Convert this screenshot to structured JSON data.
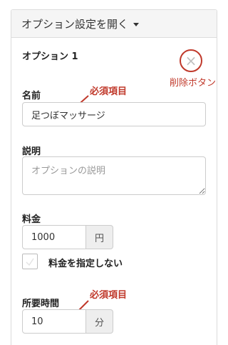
{
  "header": {
    "title": "オプション設定を開く"
  },
  "option": {
    "heading": "オプション 1",
    "remove_annotation": "削除ボタン",
    "name": {
      "label": "名前",
      "value": "足つぼマッサージ",
      "annotation": "必須項目"
    },
    "description": {
      "label": "説明",
      "placeholder": "オプションの説明"
    },
    "price": {
      "label": "料金",
      "value": "1000",
      "unit": "円",
      "no_price_label": "料金を指定しない",
      "no_price_checked": false
    },
    "duration": {
      "label": "所要時間",
      "value": "10",
      "unit": "分",
      "annotation": "必須項目"
    }
  },
  "colors": {
    "annotation": "#c0392b",
    "header_bg": "#f5f5f5",
    "addon_bg": "#eeeeee"
  },
  "icons": {
    "remove": "close-circle-icon",
    "toggle": "caret-down-icon",
    "checkbox": "checkbox-icon"
  }
}
